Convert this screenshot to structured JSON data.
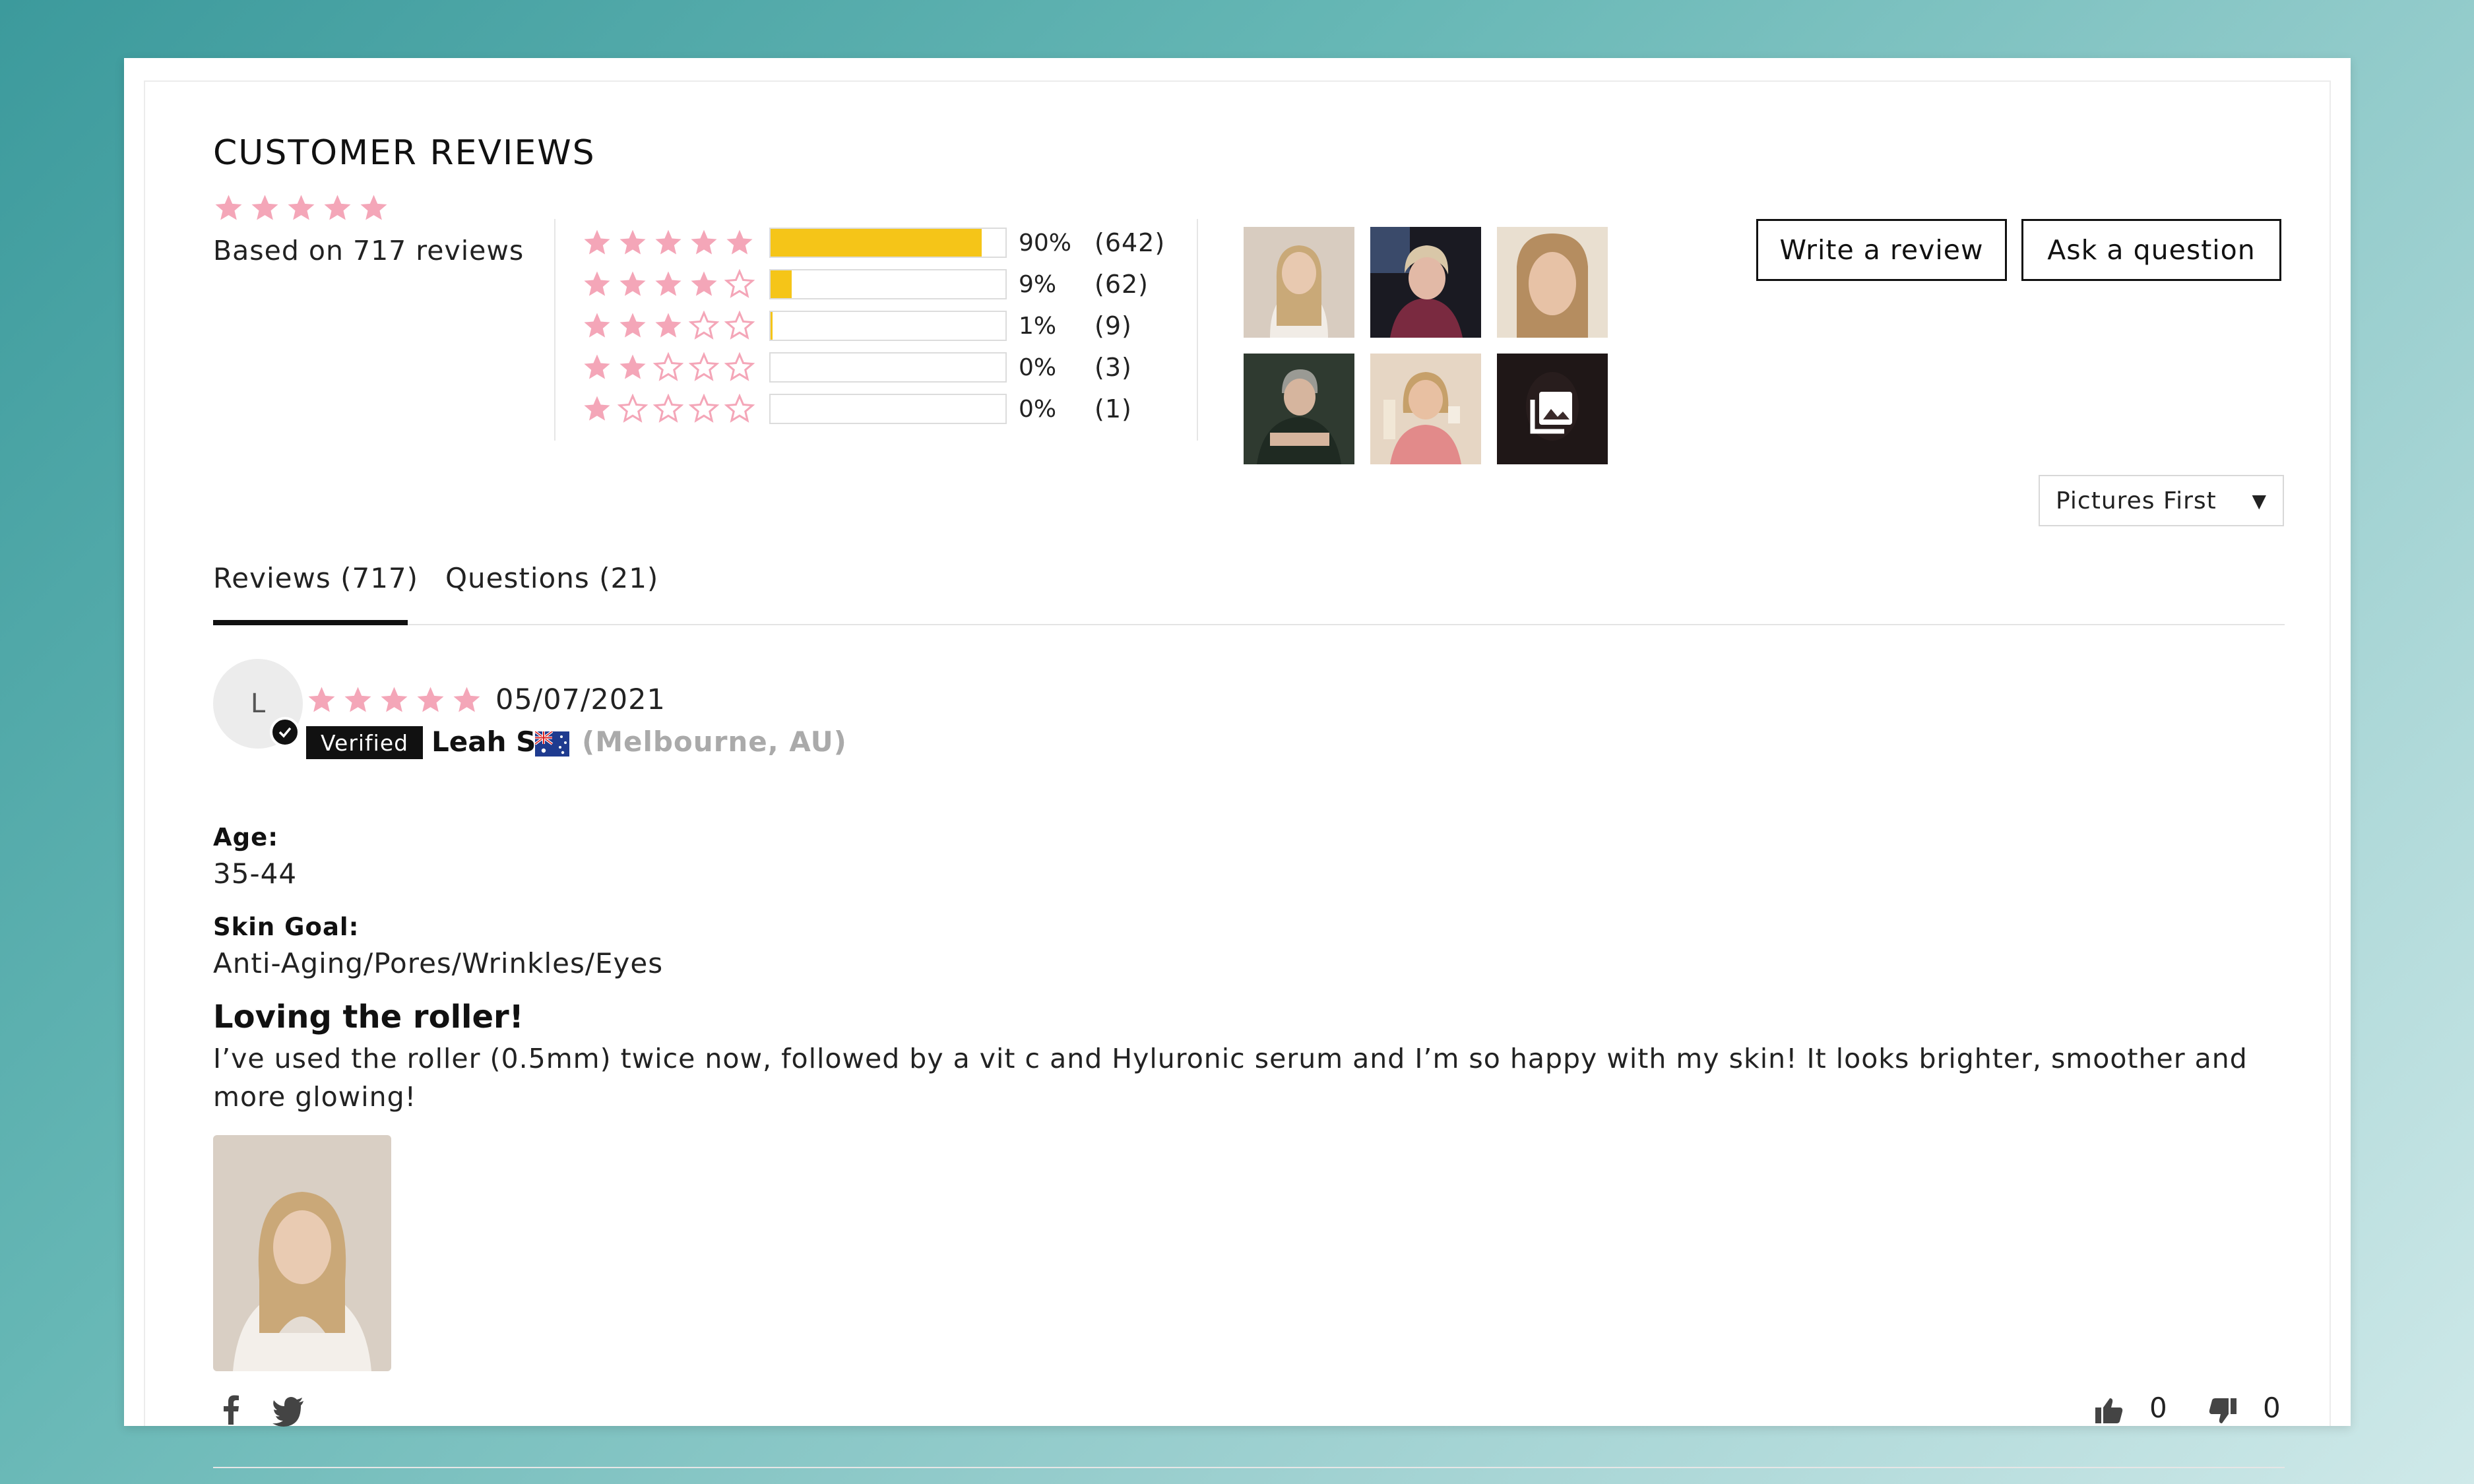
{
  "reviews_widget": {
    "title": "CUSTOMER REVIEWS",
    "average_rating": 5,
    "based_on": "Based on 717 reviews",
    "colors": {
      "star": "#f4a6b8",
      "bar_fill": "#f5c518"
    },
    "histogram": [
      {
        "stars": 5,
        "percent": "90%",
        "count": "(642)",
        "fill": 0.9
      },
      {
        "stars": 4,
        "percent": "9%",
        "count": "(62)",
        "fill": 0.09
      },
      {
        "stars": 3,
        "percent": "1%",
        "count": "(9)",
        "fill": 0.01
      },
      {
        "stars": 2,
        "percent": "0%",
        "count": "(3)",
        "fill": 0.0
      },
      {
        "stars": 1,
        "percent": "0%",
        "count": "(1)",
        "fill": 0.0
      }
    ],
    "buttons": {
      "write_review": "Write a review",
      "ask_question": "Ask a question"
    },
    "sort": {
      "selected": "Pictures First",
      "icon": "caret-down-icon"
    },
    "tabs": {
      "reviews": "Reviews (717)",
      "questions": "Questions (21)"
    }
  },
  "review": {
    "avatar_initial": "L",
    "rating": 5,
    "date": "05/07/2021",
    "verified_label": "Verified",
    "reviewer_name": "Leah S",
    "flag_icon": "australia-flag-icon",
    "location": "(Melbourne, AU)",
    "age_label": "Age:",
    "age_value": "35-44",
    "skin_goal_label": "Skin Goal:",
    "skin_goal_value": "Anti-Aging/Pores/Wrinkles/Eyes",
    "title": "Loving the roller!",
    "body": "I’ve used the roller (0.5mm) twice now, followed by a vit c and Hyluronic serum and I’m so happy with my skin! It looks brighter, smoother and more glowing!",
    "upvotes": "0",
    "downvotes": "0"
  }
}
